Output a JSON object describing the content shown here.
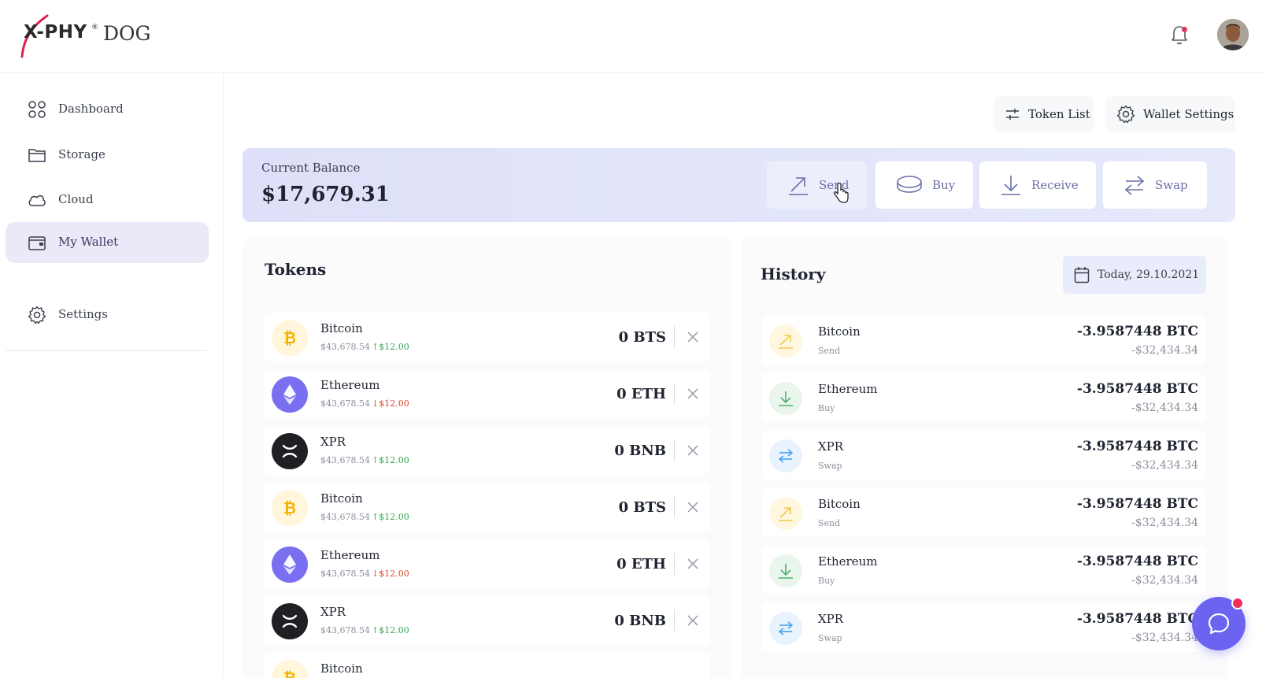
{
  "brand": {
    "name": "X-PHY",
    "registered": "®",
    "suffix": "DOG"
  },
  "sidebar": {
    "items": [
      {
        "label": "Dashboard",
        "icon": "grid-icon",
        "active": false
      },
      {
        "label": "Storage",
        "icon": "folder-icon",
        "active": false
      },
      {
        "label": "Cloud",
        "icon": "cloud-icon",
        "active": false
      },
      {
        "label": "My Wallet",
        "icon": "wallet-icon",
        "active": true
      },
      {
        "label": "Settings",
        "icon": "gear-icon",
        "active": false
      }
    ]
  },
  "toolbar": {
    "token_list": "Token List",
    "wallet_settings": "Wallet Settings"
  },
  "balance": {
    "label": "Current Balance",
    "value": "$17,679.31",
    "actions": {
      "send": "Send",
      "buy": "Buy",
      "receive": "Receive",
      "swap": "Swap"
    }
  },
  "tokens": {
    "title": "Tokens",
    "rows": [
      {
        "name": "Bitcoin",
        "price": "$43,678.54",
        "change": "↑$12.00",
        "direction": "up",
        "amount": "0 BTS",
        "coin": "bitcoin"
      },
      {
        "name": "Ethereum",
        "price": "$43,678.54",
        "change": "↓$12.00",
        "direction": "down",
        "amount": "0 ETH",
        "coin": "ethereum"
      },
      {
        "name": "XPR",
        "price": "$43,678.54",
        "change": "↑$12.00",
        "direction": "up",
        "amount": "0 BNB",
        "coin": "xpr"
      },
      {
        "name": "Bitcoin",
        "price": "$43,678.54",
        "change": "↑$12.00",
        "direction": "up",
        "amount": "0 BTS",
        "coin": "bitcoin"
      },
      {
        "name": "Ethereum",
        "price": "$43,678.54",
        "change": "↓$12.00",
        "direction": "down",
        "amount": "0 ETH",
        "coin": "ethereum"
      },
      {
        "name": "XPR",
        "price": "$43,678.54",
        "change": "↑$12.00",
        "direction": "up",
        "amount": "0 BNB",
        "coin": "xpr"
      },
      {
        "name": "Bitcoin",
        "price": "",
        "change": "",
        "direction": "up",
        "amount": "",
        "coin": "bitcoin"
      }
    ]
  },
  "history": {
    "title": "History",
    "date": "Today, 29.10.2021",
    "rows": [
      {
        "name": "Bitcoin",
        "type": "Send",
        "amount": "-3.9587448 BTC",
        "usd": "-$32,434.34",
        "kind": "send"
      },
      {
        "name": "Ethereum",
        "type": "Buy",
        "amount": "-3.9587448 BTC",
        "usd": "-$32,434.34",
        "kind": "buy"
      },
      {
        "name": "XPR",
        "type": "Swap",
        "amount": "-3.9587448 BTC",
        "usd": "-$32,434.34",
        "kind": "swap"
      },
      {
        "name": "Bitcoin",
        "type": "Send",
        "amount": "-3.9587448 BTC",
        "usd": "-$32,434.34",
        "kind": "send"
      },
      {
        "name": "Ethereum",
        "type": "Buy",
        "amount": "-3.9587448 BTC",
        "usd": "-$32,434.34",
        "kind": "buy"
      },
      {
        "name": "XPR",
        "type": "Swap",
        "amount": "-3.9587448 BTC",
        "usd": "-$32,434.34",
        "kind": "swap"
      }
    ]
  },
  "colors": {
    "accent": "#6b6fa8",
    "up": "#2fa84f",
    "down": "#e0452b",
    "bitcoin": "#f7c948",
    "ethereum": "#7a6ff0",
    "xpr": "#1f1f24",
    "chat": "#6c63f0"
  }
}
